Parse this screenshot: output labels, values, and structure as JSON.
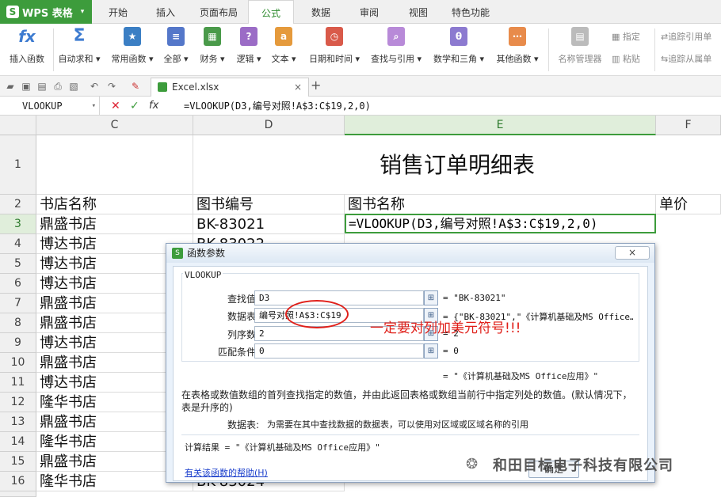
{
  "app": {
    "logo_label": "WPS 表格",
    "accent": "#3d9c3c"
  },
  "tabs": [
    "开始",
    "插入",
    "页面布局",
    "公式",
    "数据",
    "审阅",
    "视图",
    "特色功能"
  ],
  "active_tab": "公式",
  "ribbon": {
    "buttons": [
      {
        "label": "插入函数",
        "icon": "fx-icon"
      },
      {
        "label": "自动求和 ▾",
        "icon": "sigma-icon"
      },
      {
        "label": "常用函数 ▾",
        "icon": "star-book-icon"
      },
      {
        "label": "全部 ▾",
        "icon": "list-book-icon"
      },
      {
        "label": "财务 ▾",
        "icon": "finance-book-icon"
      },
      {
        "label": "逻辑 ▾",
        "icon": "question-book-icon"
      },
      {
        "label": "文本 ▾",
        "icon": "text-book-icon"
      },
      {
        "label": "日期和时间 ▾",
        "icon": "clock-book-icon"
      },
      {
        "label": "查找与引用 ▾",
        "icon": "search-book-icon"
      },
      {
        "label": "数学和三角 ▾",
        "icon": "theta-book-icon"
      },
      {
        "label": "其他函数 ▾",
        "icon": "more-book-icon"
      }
    ],
    "name_manager": "名称管理器",
    "designate": "指定",
    "paste": "粘贴",
    "trace_precedents": "追踪引用单",
    "trace_dependents": "追踪从属单"
  },
  "file_tab": {
    "label": "Excel.xlsx",
    "close": "×",
    "new": "+"
  },
  "formula_bar": {
    "name_box": "VLOOKUP",
    "cancel": "✕",
    "enter": "✓",
    "fx": "fx",
    "formula": "=VLOOKUP(D3,编号对照!A$3:C$19,2,0)"
  },
  "sheet": {
    "columns": [
      "C",
      "D",
      "E",
      "F"
    ],
    "rows": [
      "1",
      "2",
      "3",
      "4",
      "5",
      "6",
      "7",
      "8",
      "9",
      "10",
      "11",
      "12",
      "13",
      "14",
      "15",
      "16"
    ],
    "title": "销售订单明细表",
    "headers": [
      "书店名称",
      "图书编号",
      "图书名称",
      "单价"
    ],
    "active_cell_text": "=VLOOKUP(D3,编号对照!A$3:C$19,2,0)",
    "store_names": [
      "鼎盛书店",
      "博达书店",
      "博达书店",
      "博达书店",
      "鼎盛书店",
      "鼎盛书店",
      "博达书店",
      "鼎盛书店",
      "博达书店",
      "隆华书店",
      "鼎盛书店",
      "隆华书店",
      "鼎盛书店",
      "隆华书店"
    ],
    "book_ids_visible": [
      "BK-83021",
      "BK-83022",
      "BK-83024"
    ]
  },
  "dialog": {
    "title": "函数参数",
    "close": "×",
    "function_name": "VLOOKUP",
    "params": [
      {
        "label": "查找值",
        "value": "D3",
        "result": "= \"BK-83021\""
      },
      {
        "label": "数据表",
        "value": "编号对照!A$3:C$19",
        "result": "= {\"BK-83021\",\"《计算机基础及MS Office…"
      },
      {
        "label": "列序数",
        "value": "2",
        "result": "= 2"
      },
      {
        "label": "匹配条件",
        "value": "0",
        "result": "= 0"
      }
    ],
    "formula_result_inline": "= \"《计算机基础及MS Office应用》\"",
    "description": "在表格或数值数组的首列查找指定的数值，并由此返回表格或数组当前行中指定列处的数值。(默认情况下，表是升序的)",
    "param_desc_label": "数据表:",
    "param_desc": "为需要在其中查找数据的数据表，可以使用对区域或区域名称的引用",
    "calc_result": "计算结果 = \"《计算机基础及MS Office应用》\"",
    "help_link": "有关该函数的帮助(H)",
    "ok": "确定"
  },
  "annotation": "一定要对列加美元符号!!!",
  "annotation_color": "#e0201a",
  "watermark": "和田目标电子科技有限公司"
}
